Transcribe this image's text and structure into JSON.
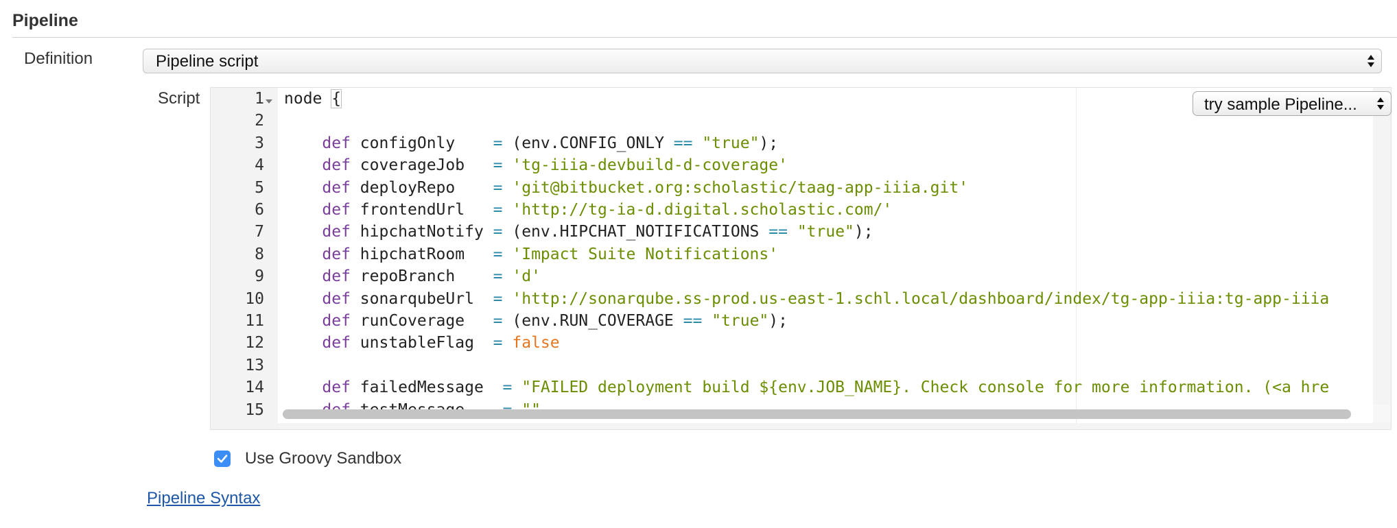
{
  "section": {
    "title": "Pipeline"
  },
  "definition": {
    "label": "Definition",
    "selected": "Pipeline script"
  },
  "script": {
    "label": "Script",
    "sample_select": "try sample Pipeline...",
    "line_numbers": [
      "1",
      "2",
      "3",
      "4",
      "5",
      "6",
      "7",
      "8",
      "9",
      "10",
      "11",
      "12",
      "13",
      "14",
      "15"
    ],
    "lines": [
      [
        {
          "t": "node ",
          "c": ""
        },
        {
          "t": "{",
          "c": "bracket"
        }
      ],
      [],
      [
        {
          "t": "    def",
          "c": "kw"
        },
        {
          "t": " configOnly    ",
          "c": ""
        },
        {
          "t": "=",
          "c": "op"
        },
        {
          "t": " (env.CONFIG_ONLY ",
          "c": ""
        },
        {
          "t": "==",
          "c": "op"
        },
        {
          "t": " ",
          "c": ""
        },
        {
          "t": "\"true\"",
          "c": "str"
        },
        {
          "t": ");",
          "c": ""
        }
      ],
      [
        {
          "t": "    def",
          "c": "kw"
        },
        {
          "t": " coverageJob   ",
          "c": ""
        },
        {
          "t": "=",
          "c": "op"
        },
        {
          "t": " ",
          "c": ""
        },
        {
          "t": "'tg-iiia-devbuild-d-coverage'",
          "c": "str"
        }
      ],
      [
        {
          "t": "    def",
          "c": "kw"
        },
        {
          "t": " deployRepo    ",
          "c": ""
        },
        {
          "t": "=",
          "c": "op"
        },
        {
          "t": " ",
          "c": ""
        },
        {
          "t": "'git@bitbucket.org:scholastic/taag-app-iiia.git'",
          "c": "str"
        }
      ],
      [
        {
          "t": "    def",
          "c": "kw"
        },
        {
          "t": " frontendUrl   ",
          "c": ""
        },
        {
          "t": "=",
          "c": "op"
        },
        {
          "t": " ",
          "c": ""
        },
        {
          "t": "'http://tg-ia-d.digital.scholastic.com/'",
          "c": "str"
        }
      ],
      [
        {
          "t": "    def",
          "c": "kw"
        },
        {
          "t": " hipchatNotify ",
          "c": ""
        },
        {
          "t": "=",
          "c": "op"
        },
        {
          "t": " (env.HIPCHAT_NOTIFICATIONS ",
          "c": ""
        },
        {
          "t": "==",
          "c": "op"
        },
        {
          "t": " ",
          "c": ""
        },
        {
          "t": "\"true\"",
          "c": "str"
        },
        {
          "t": ");",
          "c": ""
        }
      ],
      [
        {
          "t": "    def",
          "c": "kw"
        },
        {
          "t": " hipchatRoom   ",
          "c": ""
        },
        {
          "t": "=",
          "c": "op"
        },
        {
          "t": " ",
          "c": ""
        },
        {
          "t": "'Impact Suite Notifications'",
          "c": "str"
        }
      ],
      [
        {
          "t": "    def",
          "c": "kw"
        },
        {
          "t": " repoBranch    ",
          "c": ""
        },
        {
          "t": "=",
          "c": "op"
        },
        {
          "t": " ",
          "c": ""
        },
        {
          "t": "'d'",
          "c": "str"
        }
      ],
      [
        {
          "t": "    def",
          "c": "kw"
        },
        {
          "t": " sonarqubeUrl  ",
          "c": ""
        },
        {
          "t": "=",
          "c": "op"
        },
        {
          "t": " ",
          "c": ""
        },
        {
          "t": "'http://sonarqube.ss-prod.us-east-1.schl.local/dashboard/index/tg-app-iiia:tg-app-iiia",
          "c": "str"
        }
      ],
      [
        {
          "t": "    def",
          "c": "kw"
        },
        {
          "t": " runCoverage   ",
          "c": ""
        },
        {
          "t": "=",
          "c": "op"
        },
        {
          "t": " (env.RUN_COVERAGE ",
          "c": ""
        },
        {
          "t": "==",
          "c": "op"
        },
        {
          "t": " ",
          "c": ""
        },
        {
          "t": "\"true\"",
          "c": "str"
        },
        {
          "t": ");",
          "c": ""
        }
      ],
      [
        {
          "t": "    def",
          "c": "kw"
        },
        {
          "t": " unstableFlag  ",
          "c": ""
        },
        {
          "t": "=",
          "c": "op"
        },
        {
          "t": " ",
          "c": ""
        },
        {
          "t": "false",
          "c": "bool"
        }
      ],
      [],
      [
        {
          "t": "    def",
          "c": "kw"
        },
        {
          "t": " failedMessage  ",
          "c": ""
        },
        {
          "t": "=",
          "c": "op"
        },
        {
          "t": " ",
          "c": ""
        },
        {
          "t": "\"FAILED deployment build ${env.JOB_NAME}. Check console for more information. (<a hre",
          "c": "str"
        }
      ],
      [
        {
          "t": "    def",
          "c": "kw"
        },
        {
          "t": " testMessage    ",
          "c": ""
        },
        {
          "t": "=",
          "c": "op"
        },
        {
          "t": " ",
          "c": ""
        },
        {
          "t": "\"\"",
          "c": "str"
        }
      ]
    ]
  },
  "sandbox": {
    "label": "Use Groovy Sandbox",
    "checked": true
  },
  "syntax_link": {
    "label": "Pipeline Syntax"
  },
  "colors": {
    "accent": "#3b8ef6",
    "link": "#1f57a8",
    "keyword": "#7a3e9d",
    "string": "#6b8e00",
    "boolean": "#e5761f",
    "operator": "#2a8aa8"
  }
}
